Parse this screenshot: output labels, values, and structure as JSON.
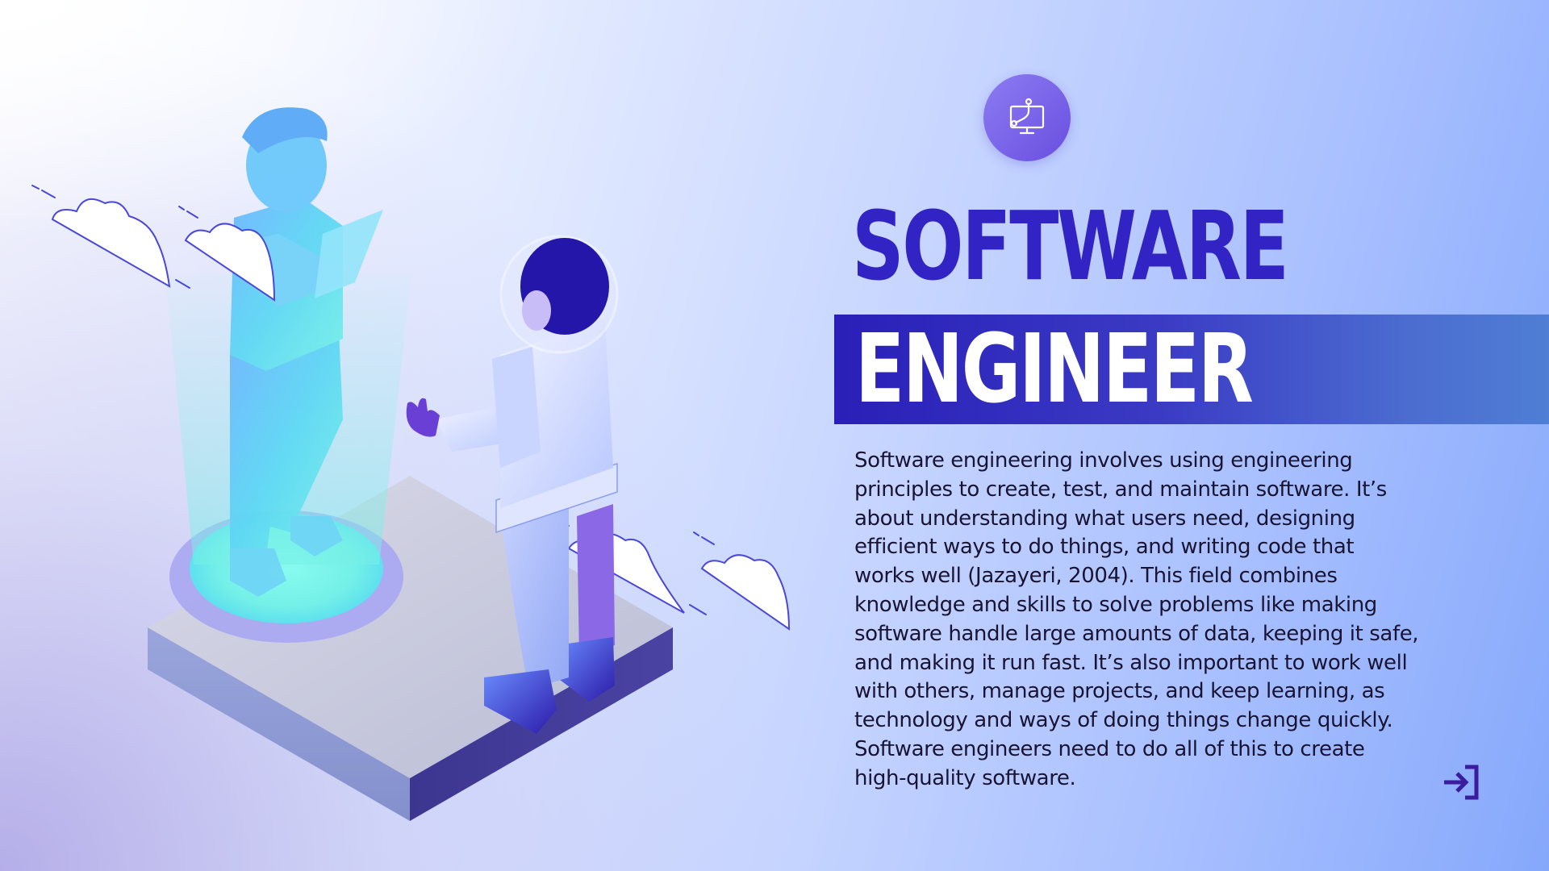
{
  "slide": {
    "title_line1": "SOFTWARE",
    "title_line2": "ENGINEER",
    "description": "Software engineering involves using engineering principles to create, test, and maintain software. It’s about understanding what users need, designing efficient ways to do things, and writing code that works well (Jazayeri, 2004). This field combines knowledge and skills to solve problems like making software handle large amounts of data, keeping it safe, and making it run fast. It’s also important to work well with others, manage projects, and keep learning, as technology and ways of doing things change quickly. Software engineers need to do all of this to create high-quality software."
  },
  "icons": {
    "header_icon": "software-design-icon",
    "nav_icon": "arrow-into-bracket-icon"
  },
  "colors": {
    "title_primary": "#3224c4",
    "title_band": "#2a1fb8",
    "title_secondary": "#ffffff",
    "body_text": "#1a1433",
    "accent": "#6a4fe0"
  }
}
